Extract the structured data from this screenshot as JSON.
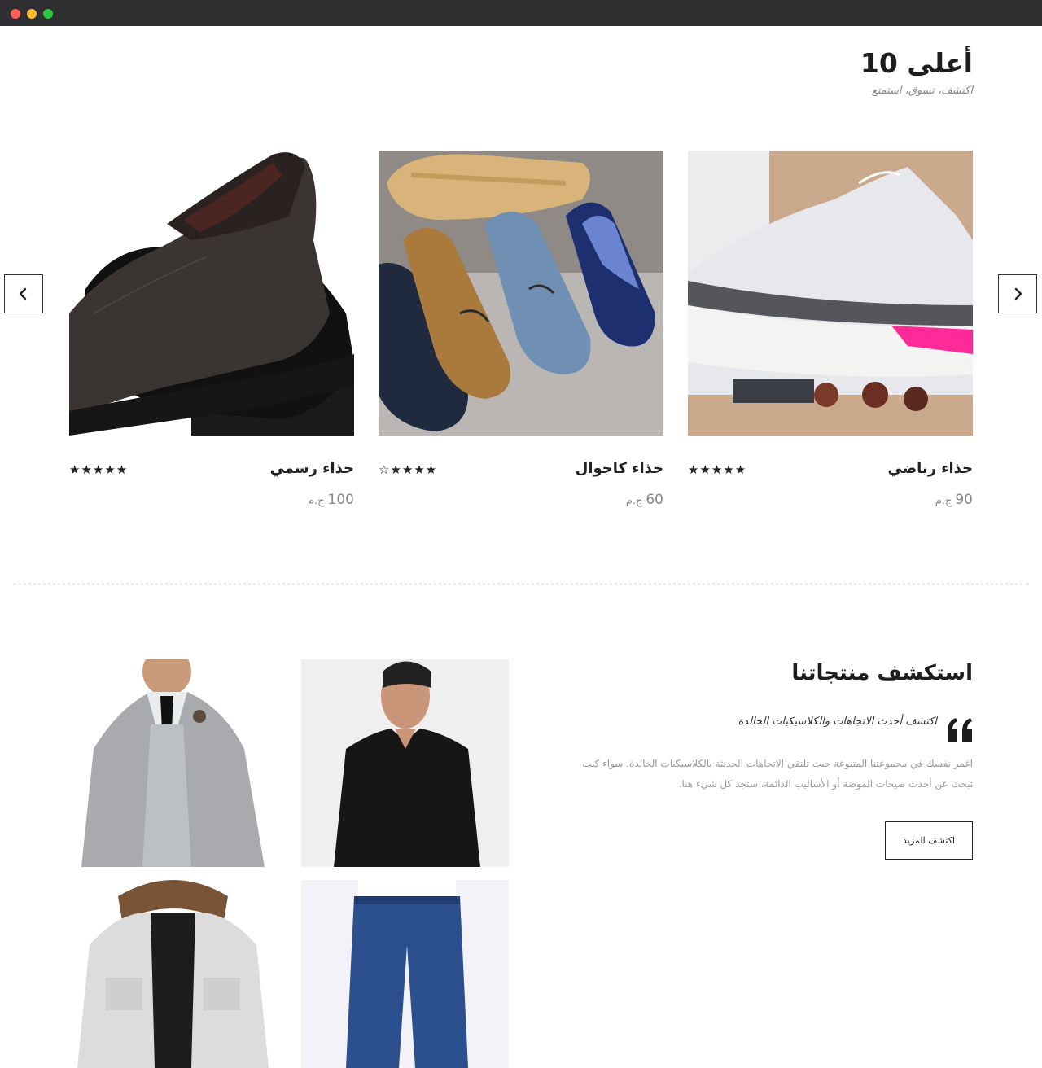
{
  "top_section": {
    "title": "أعلى 10",
    "subtitle": "اكتشف، تسوق، استمتع"
  },
  "carousel": {
    "prev_icon": "chevron-left-icon",
    "next_icon": "chevron-right-icon",
    "products": [
      {
        "name": "حذاء رسمي",
        "stars": "★★★★★",
        "rating": 5,
        "price": "100",
        "currency": "ج.م"
      },
      {
        "name": "حذاء كاجوال",
        "stars": "☆★★★★",
        "rating": 4,
        "price": "60",
        "currency": "ج.م"
      },
      {
        "name": "حذاء رياضي",
        "stars": "★★★★★",
        "rating": 5,
        "price": "90",
        "currency": "ج.م"
      }
    ]
  },
  "explore": {
    "title": "استكشف منتجاتنا",
    "quote": "اكتشف أحدث الاتجاهات والكلاسيكيات الخالدة",
    "paragraph": "اغمر نفسك في مجموعتنا المتنوعة حيث تلتقي الاتجاهات الحديثة بالكلاسيكيات الخالدة. سواء كنت تبحث عن أحدث صيحات الموضة أو الأساليب الدائمة، ستجد كل شيء هنا.",
    "button_label": "اكتشف المزيد"
  },
  "colors": {
    "titlebar": "#2f2f31",
    "text_dark": "#1d1d1d",
    "text_muted": "#888888"
  }
}
